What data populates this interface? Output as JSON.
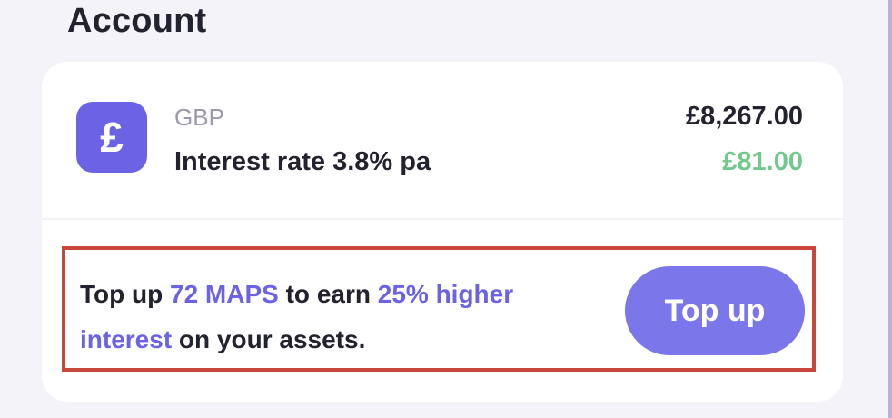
{
  "section": {
    "title": "Account"
  },
  "account": {
    "currency_symbol": "£",
    "currency_code": "GBP",
    "interest_rate_text": "Interest rate 3.8% pa",
    "balance": "£8,267.00",
    "earned": "£81.00"
  },
  "promo": {
    "text_1": "Top up ",
    "highlight_1": "72 MAPS",
    "text_2": " to earn ",
    "highlight_2": "25% higher interest",
    "text_3": " on your assets.",
    "button_label": "Top up"
  },
  "colors": {
    "accent": "#6b62e6",
    "button": "#7b76e9",
    "positive": "#72c98d",
    "highlight_border": "#c9473a"
  },
  "icons": {
    "currency": "pound-icon"
  }
}
